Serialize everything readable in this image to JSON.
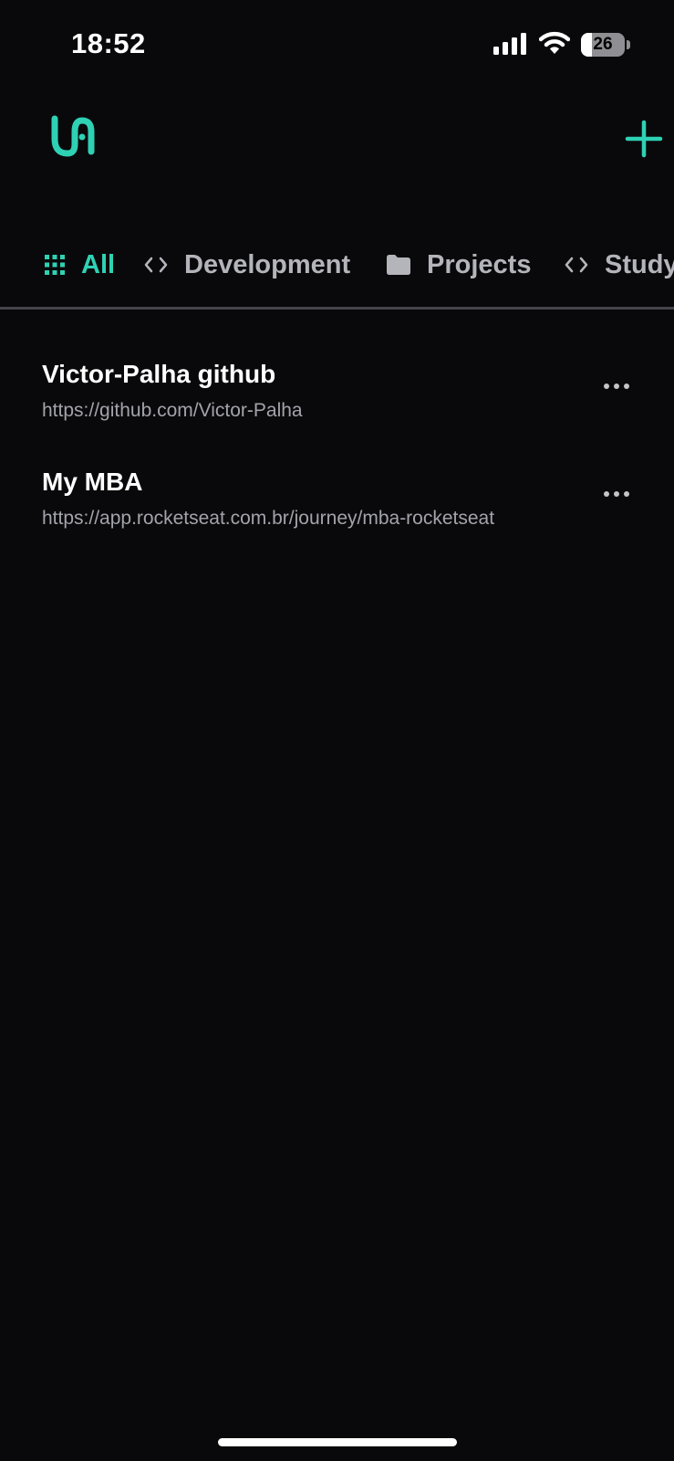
{
  "status_bar": {
    "time": "18:52",
    "battery_level": "26",
    "battery_fraction": 0.26,
    "icons": [
      "signal-icon",
      "wifi-icon",
      "battery-icon"
    ]
  },
  "header": {
    "logo_icon": "link-logo-icon",
    "add_icon": "plus-icon",
    "accent_color": "#2fd1b4"
  },
  "categories": [
    {
      "label": "All",
      "icon": "grid-icon",
      "active": true
    },
    {
      "label": "Development",
      "icon": "code-icon",
      "active": false
    },
    {
      "label": "Projects",
      "icon": "folder-icon",
      "active": false
    },
    {
      "label": "Study",
      "icon": "code-icon",
      "active": false
    }
  ],
  "links": [
    {
      "name": "Victor-Palha github",
      "url": "https://github.com/Victor-Palha",
      "menu_icon": "more-icon"
    },
    {
      "name": "My MBA",
      "url": "https://app.rocketseat.com.br/journey/mba-rocketseat",
      "menu_icon": "more-icon"
    }
  ],
  "colors": {
    "background": "#09090b",
    "accent": "#2fd1b4",
    "inactive_text": "#b4b4bb",
    "secondary_text": "#a3a3ab",
    "divider": "#44444c"
  }
}
